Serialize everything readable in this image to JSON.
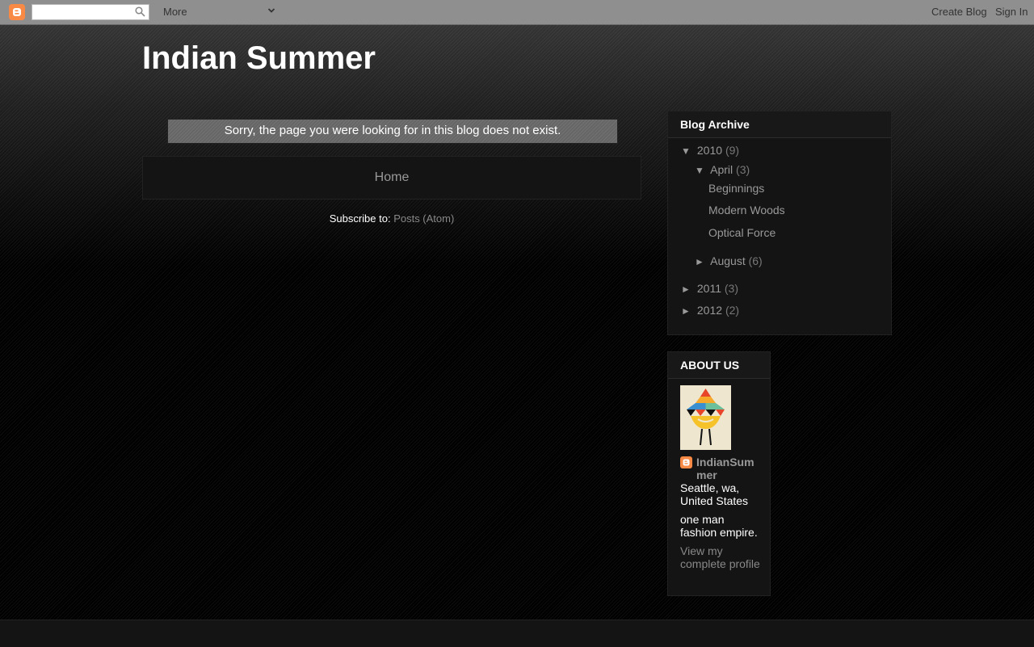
{
  "navbar": {
    "more_label": "More",
    "create_blog": "Create Blog",
    "sign_in": "Sign In",
    "search_placeholder": ""
  },
  "blog": {
    "title": "Indian Summer"
  },
  "main": {
    "status_message": "Sorry, the page you were looking for in this blog does not exist.",
    "home_link": "Home",
    "subscribe_label": "Subscribe to:",
    "subscribe_link": "Posts (Atom)"
  },
  "archive": {
    "title": "Blog Archive",
    "years": [
      {
        "toggle": "▼",
        "label": "2010",
        "count": "(9)"
      },
      {
        "toggle": "►",
        "label": "2011",
        "count": "(3)"
      },
      {
        "toggle": "►",
        "label": "2012",
        "count": "(2)"
      }
    ],
    "months": [
      {
        "toggle": "▼",
        "label": "April",
        "count": "(3)"
      },
      {
        "toggle": "►",
        "label": "August",
        "count": "(6)"
      }
    ],
    "posts": [
      "Beginnings",
      "Modern Woods",
      "Optical Force"
    ]
  },
  "about": {
    "title": "ABOUT US",
    "name": "IndianSummer",
    "location": "Seattle, wa, United States",
    "description": "one man fashion empire.",
    "view_profile": "View my complete profile"
  },
  "colors": {
    "navbar": "#8f8f8f",
    "blogger_orange": "#f98a45",
    "link": "#999999",
    "widget_bg": "#141414"
  }
}
